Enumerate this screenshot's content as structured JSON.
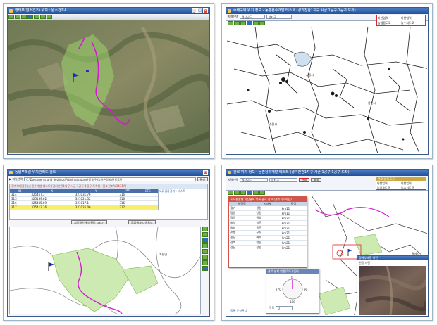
{
  "panels": {
    "top_left": {
      "title": "행태부(원소건조) 위치 : 원소건조A"
    },
    "top_right": {
      "title": "수배구역 위치 정보 - 농촌용수개발 테스트 (경기천관1지구 시군 1공구 1공구 도착)",
      "region_select": "지역선택",
      "si_select": "경상남도",
      "gu_select": "성지구",
      "checks": [
        "마천입력",
        "마천입력",
        "농업용도로",
        "농수지도로"
      ]
    },
    "bottom_left": {
      "title": "농업부패결 위치관리도 검토",
      "file_path": "C:\\Documents and Settings\\Administrator\\바탕 화면\\농어촌정비\\관로도면",
      "confirm_button": "확인",
      "table_title": "경계부패결 [농촌용수개발 테스트 (경기천관1지구 시군 1공구 1공구 도착)] : 원소건조A(3431A)",
      "side_label": "오류검증결과 : 테스트",
      "columns": [
        "ID",
        "X",
        "Y",
        "코드",
        "ETC"
      ],
      "rows": [
        [
          "314",
          "325467.3",
          "321031.76",
          "316",
          ""
        ],
        [
          "315",
          "325439.62",
          "321021.52",
          "316",
          ""
        ],
        [
          "316",
          "325435.69",
          "321017.1",
          "316",
          ""
        ],
        [
          "317",
          "325413.16",
          "321026.06",
          "317",
          ""
        ]
      ],
      "highlight_row": 3,
      "buttons": [
        "지도확인 위치관로 그리기",
        "검증결과 다운로드"
      ],
      "map_place": "자용면"
    },
    "bottom_right": {
      "title": "관로 위치 정보 - 농촌용수개발 테스트 (경기천관1지구 시군 1공구 1공구 도착)",
      "region_select": "지역선택",
      "si_select": "경상남도",
      "gu_select": "성지구",
      "search_button": "검색",
      "reset_button": "초기",
      "legend_title": "관로 입력 도구",
      "legend_checks": [
        "마천입력",
        "마천입력",
        "농업용도로",
        "농수지도로"
      ],
      "list_title": "시도현황별 지상관비 목록 관로 정보 (관리되어야함)",
      "list_columns": [
        "분량명",
        "지자체",
        "길이"
      ],
      "list_rows": [
        [
          "경기",
          "강원",
          "km11"
        ],
        [
          "강원",
          "강원",
          "km11"
        ],
        [
          "강원",
          "평창",
          "km21"
        ],
        [
          "충북",
          "청주",
          "km21"
        ],
        [
          "충남",
          "공주",
          "km21"
        ],
        [
          "전북",
          "군산",
          "km21"
        ],
        [
          "전남",
          "여수",
          "km21"
        ],
        [
          "경북",
          "안동",
          "km21"
        ],
        [
          "경남",
          "창원",
          "km21"
        ]
      ],
      "compass_title": "관로 설치 방향(각도) 입력",
      "compass_labels": [
        "0",
        "90",
        "180",
        "270"
      ],
      "angle_label": "각도",
      "angle_value": "0",
      "photo_title": "경계부패결 사진",
      "photo_caption": "현장 사진",
      "map_place": "달계리",
      "footer_link": "목록 운영관리"
    }
  },
  "colors": {
    "titlebar": "#21509c",
    "toolbar_green": "#6fb043",
    "route_magenta": "#d21bd0",
    "field_green": "#9ad66b",
    "highlight": "#f7ee6a",
    "alert_red": "#e0262b"
  }
}
